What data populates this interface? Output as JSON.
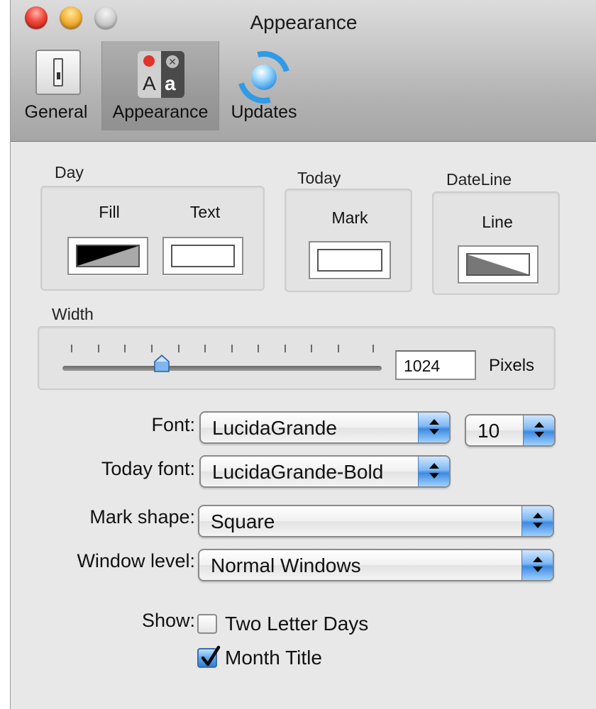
{
  "window": {
    "title": "Appearance"
  },
  "toolbar": {
    "items": [
      {
        "label": "General",
        "icon": "switch-icon"
      },
      {
        "label": "Appearance",
        "icon": "font-style-icon",
        "selected": true
      },
      {
        "label": "Updates",
        "icon": "sync-icon"
      }
    ]
  },
  "colors": {
    "day": {
      "label": "Day",
      "fill_label": "Fill",
      "text_label": "Text"
    },
    "today": {
      "label": "Today",
      "mark_label": "Mark"
    },
    "dateline": {
      "label": "DateLine",
      "line_label": "Line"
    }
  },
  "width": {
    "label": "Width",
    "value": "1024",
    "unit": "Pixels",
    "slider_fraction": 0.31
  },
  "form": {
    "font": {
      "label": "Font:",
      "value": "LucidaGrande",
      "size": "10"
    },
    "today_font": {
      "label": "Today font:",
      "value": "LucidaGrande-Bold"
    },
    "mark_shape": {
      "label": "Mark shape:",
      "value": "Square"
    },
    "window_level": {
      "label": "Window level:",
      "value": "Normal Windows"
    }
  },
  "show": {
    "label": "Show:",
    "options": [
      {
        "label": "Two Letter Days",
        "checked": false
      },
      {
        "label": "Month Title",
        "checked": true
      }
    ]
  }
}
